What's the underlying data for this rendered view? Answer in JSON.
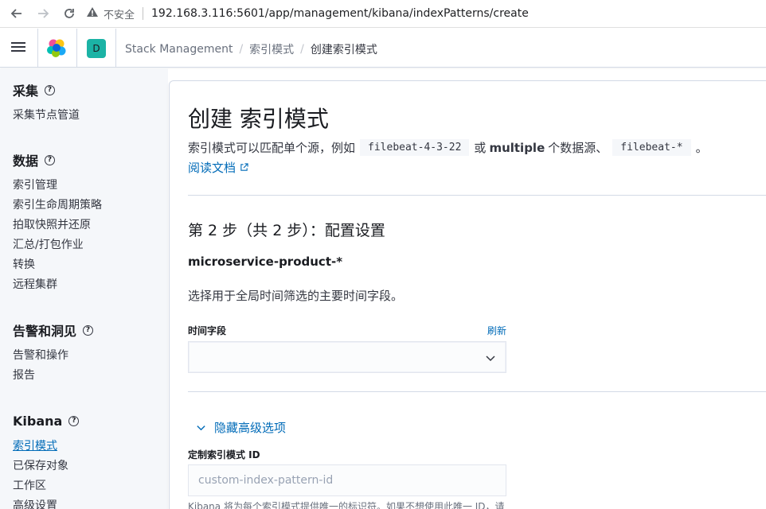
{
  "browser": {
    "insecure_label": "不安全",
    "url": "192.168.3.116:5601/app/management/kibana/indexPatterns/create"
  },
  "header": {
    "space_initial": "D",
    "breadcrumbs": [
      "Stack Management",
      "索引模式",
      "创建索引模式"
    ]
  },
  "sidebar": {
    "sections": [
      {
        "title": "采集",
        "items": [
          "采集节点管道"
        ]
      },
      {
        "title": "数据",
        "items": [
          "索引管理",
          "索引生命周期策略",
          "拍取快照并还原",
          "汇总/打包作业",
          "转换",
          "远程集群"
        ]
      },
      {
        "title": "告警和洞见",
        "items": [
          "告警和操作",
          "报告"
        ]
      },
      {
        "title": "Kibana",
        "items": [
          "索引模式",
          "已保存对象",
          "工作区",
          "高级设置"
        ]
      }
    ],
    "active_item": "索引模式"
  },
  "main": {
    "title": "创建 索引模式",
    "desc_prefix": "索引模式可以匹配单个源，例如",
    "code_example_1": "filebeat-4-3-22",
    "desc_or": "或",
    "desc_bold": "multiple",
    "desc_mid": "个数据源、",
    "code_example_2": "filebeat-*",
    "desc_end": "。",
    "doc_link": "阅读文档",
    "step_title": "第 2 步（共 2 步）：配置设置",
    "pattern_name": "microservice-product-*",
    "help_text": "选择用于全局时间筛选的主要时间字段。",
    "time_field_label": "时间字段",
    "refresh_label": "刷新",
    "time_field_value": "",
    "advanced_toggle": "隐藏高级选项",
    "custom_id_label": "定制索引模式 ID",
    "custom_id_placeholder": "custom-index-pattern-id",
    "custom_id_help": "Kibana 将为每个索引模式提供唯一的标识符。如果不想使用此唯一 ID，请"
  },
  "colors": {
    "link": "#006bb8",
    "space_avatar": "#1bb3a5"
  }
}
